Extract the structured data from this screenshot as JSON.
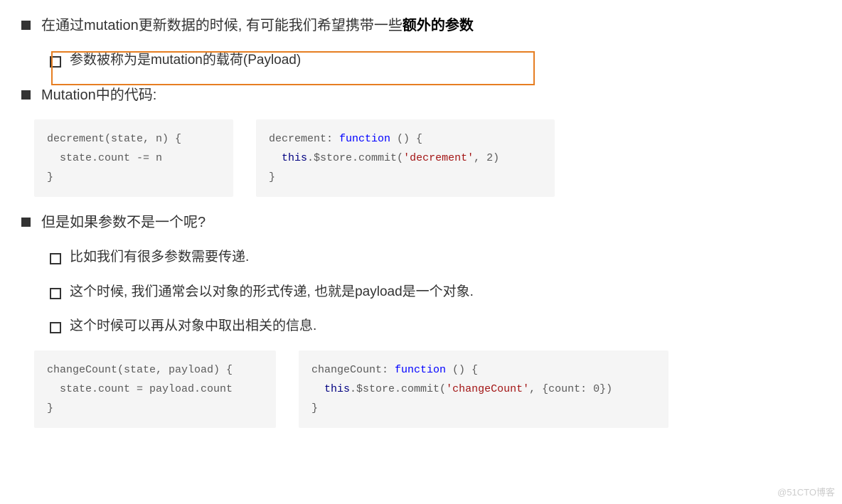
{
  "bullets": {
    "b1_pre": "在通过mutation更新数据的时候, 有可能我们希望携带一些",
    "b1_bold": "额外的参数",
    "b2": "参数被称为是mutation的载荷(Payload)",
    "b3": "Mutation中的代码:",
    "b4": "但是如果参数不是一个呢?",
    "b5": "比如我们有很多参数需要传递.",
    "b6": "这个时候, 我们通常会以对象的形式传递, 也就是payload是一个对象.",
    "b7": "这个时候可以再从对象中取出相关的信息."
  },
  "code": {
    "block1_line1a": "decrement",
    "block1_line1b": "(state, n) {",
    "block1_line2": "  state.count -= n",
    "block1_line3": "}",
    "block2_line1a": "decrement: ",
    "block2_line1b": "function",
    "block2_line1c": " () {",
    "block2_line2a": "  ",
    "block2_line2b": "this",
    "block2_line2c": ".$store.commit(",
    "block2_line2d": "'decrement'",
    "block2_line2e": ", 2)",
    "block2_line3": "}",
    "block3_line1a": "changeCount",
    "block3_line1b": "(state, payload) {",
    "block3_line2": "  state.count = payload.count",
    "block3_line3": "}",
    "block4_line1a": "changeCount: ",
    "block4_line1b": "function",
    "block4_line1c": " () {",
    "block4_line2a": "  ",
    "block4_line2b": "this",
    "block4_line2c": ".$store.commit(",
    "block4_line2d": "'changeCount'",
    "block4_line2e": ", {count: 0})",
    "block4_line3": "}"
  },
  "watermark": "@51CTO博客"
}
